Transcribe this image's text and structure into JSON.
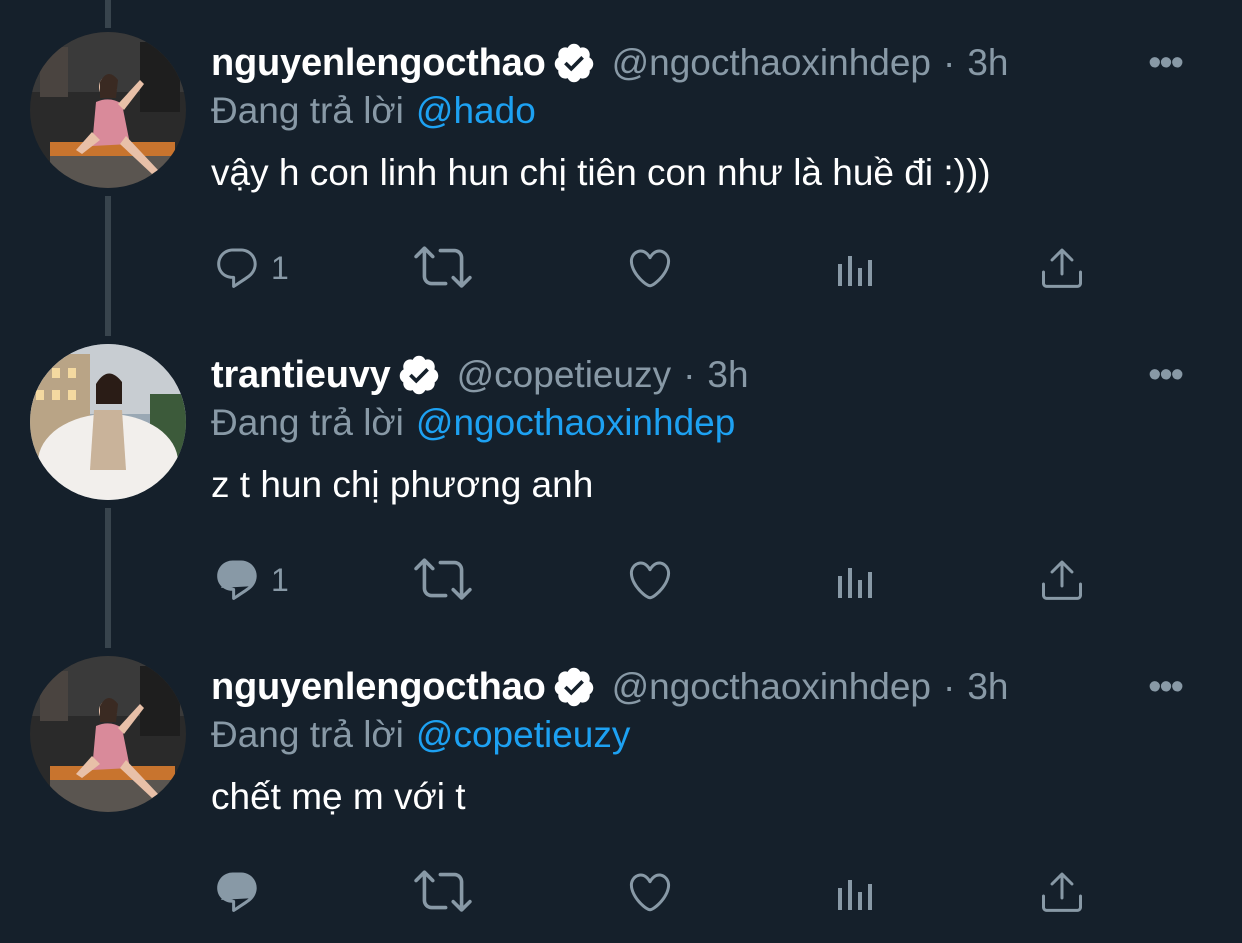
{
  "tweets": [
    {
      "display_name": "nguyenlengocthao",
      "handle": "@ngocthaoxinhdep",
      "separator": "·",
      "time": "3h",
      "more": "•••",
      "reply_prefix": "Đang trả lời",
      "reply_to": "@hado",
      "text": "vậy h con linh hun chị tiên con như là huề đi :)))",
      "reply_count": "1",
      "verified": true,
      "avatar_icon": "avatar-pink-dress"
    },
    {
      "display_name": "trantieuvy",
      "handle": "@copetieuzy",
      "separator": "·",
      "time": "3h",
      "more": "•••",
      "reply_prefix": "Đang trả lời",
      "reply_to": "@ngocthaoxinhdep",
      "text": "z t hun chị phương anh",
      "reply_count": "1",
      "verified": true,
      "avatar_icon": "avatar-white-fur"
    },
    {
      "display_name": "nguyenlengocthao",
      "handle": "@ngocthaoxinhdep",
      "separator": "·",
      "time": "3h",
      "more": "•••",
      "reply_prefix": "Đang trả lời",
      "reply_to": "@copetieuzy",
      "text": "chết mẹ m với t",
      "reply_count": "",
      "verified": true,
      "avatar_icon": "avatar-pink-dress"
    }
  ],
  "colors": {
    "background": "#15202b",
    "thread_line": "#38444d",
    "secondary_text": "#8899a6",
    "link": "#1da1f2",
    "verified_badge": "#ffffff"
  },
  "icons": [
    "reply-icon",
    "retweet-icon",
    "like-icon",
    "analytics-icon",
    "share-icon",
    "verified-badge-icon",
    "more-icon"
  ]
}
